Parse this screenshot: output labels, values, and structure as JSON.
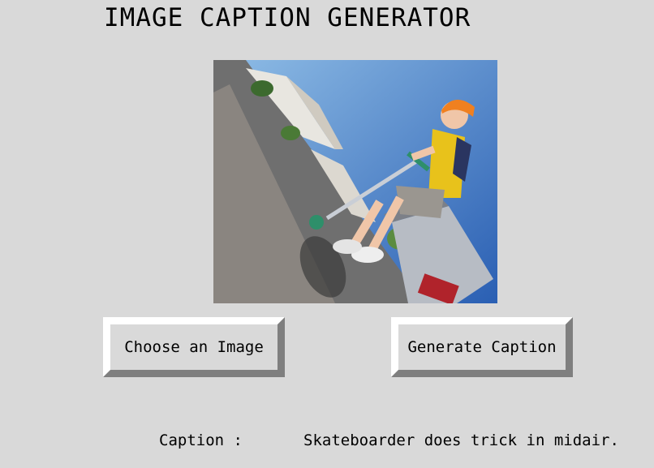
{
  "window": {
    "title": "IMAGE CAPTION GENERATOR"
  },
  "image": {
    "description_icon": "photo-icon"
  },
  "buttons": {
    "choose_label": "Choose an Image",
    "generate_label": "Generate Caption"
  },
  "caption": {
    "label": "Caption :",
    "text": "Skateboarder does trick in midair."
  },
  "colors": {
    "background": "#d9d9d9",
    "button_face": "#d9d9d9",
    "button_highlight": "#ffffff",
    "button_shadow": "#7f7f7f"
  }
}
